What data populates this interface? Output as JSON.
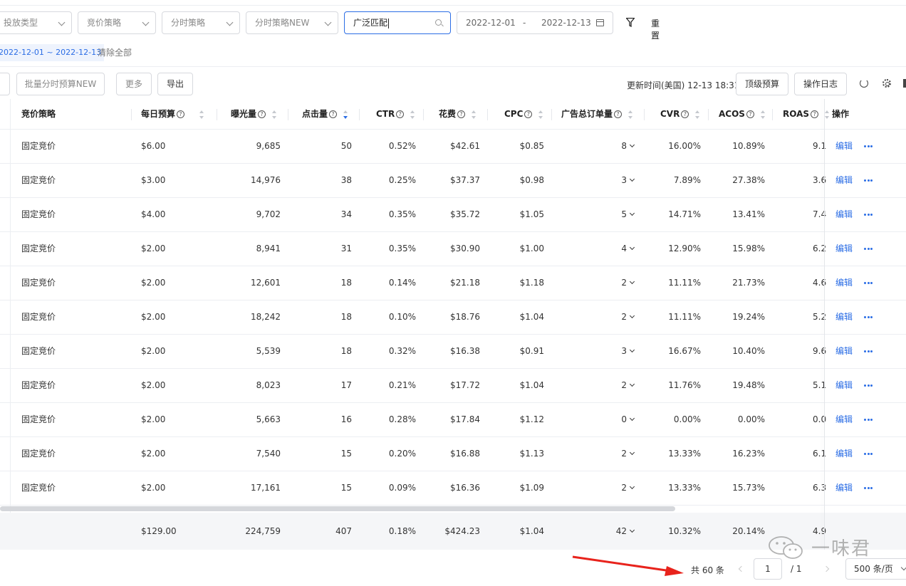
{
  "filters": {
    "delivery_type": "投放类型",
    "bid_strategy": "竞价策略",
    "dayparting": "分时策略",
    "dayparting_new": "分时策略NEW",
    "search_value": "广泛匹配",
    "date_start": "2022-12-01",
    "date_sep": "-",
    "date_end": "2022-12-13",
    "reset": "重置"
  },
  "active_tag": "2022-12-01 ~ 2022-12-13",
  "clear_all": "清除全部",
  "toolbar": {
    "batch_budget": "批量分时预算NEW",
    "more": "更多",
    "export": "导出",
    "updated_at": "更新时间(美国) 12-13 18:31",
    "top_budget": "顶级预算",
    "op_log": "操作日志"
  },
  "columns": {
    "bid": "竞价策略",
    "budget": "每日预算",
    "impr": "曝光量",
    "clicks": "点击量",
    "ctr": "CTR",
    "spend": "花费",
    "cpc": "CPC",
    "orders": "广告总订单量",
    "cvr": "CVR",
    "acos": "ACOS",
    "roas": "ROAS",
    "ops": "操作"
  },
  "rows": [
    {
      "bid": "固定竞价",
      "budget": "$6.00",
      "impr": "9,685",
      "clicks": "50",
      "ctr": "0.52%",
      "spend": "$42.61",
      "cpc": "$0.85",
      "orders": "8",
      "cvr": "16.00%",
      "acos": "10.89%",
      "roas": "9.1",
      "edit": "编辑"
    },
    {
      "bid": "固定竞价",
      "budget": "$3.00",
      "impr": "14,976",
      "clicks": "38",
      "ctr": "0.25%",
      "spend": "$37.37",
      "cpc": "$0.98",
      "orders": "3",
      "cvr": "7.89%",
      "acos": "27.38%",
      "roas": "3.6",
      "edit": "编辑"
    },
    {
      "bid": "固定竞价",
      "budget": "$4.00",
      "impr": "9,702",
      "clicks": "34",
      "ctr": "0.35%",
      "spend": "$35.72",
      "cpc": "$1.05",
      "orders": "5",
      "cvr": "14.71%",
      "acos": "13.41%",
      "roas": "7.4",
      "edit": "编辑"
    },
    {
      "bid": "固定竞价",
      "budget": "$2.00",
      "impr": "8,941",
      "clicks": "31",
      "ctr": "0.35%",
      "spend": "$30.90",
      "cpc": "$1.00",
      "orders": "4",
      "cvr": "12.90%",
      "acos": "15.98%",
      "roas": "6.2",
      "edit": "编辑"
    },
    {
      "bid": "固定竞价",
      "budget": "$2.00",
      "impr": "12,601",
      "clicks": "18",
      "ctr": "0.14%",
      "spend": "$21.18",
      "cpc": "$1.18",
      "orders": "2",
      "cvr": "11.11%",
      "acos": "21.73%",
      "roas": "4.6",
      "edit": "编辑"
    },
    {
      "bid": "固定竞价",
      "budget": "$2.00",
      "impr": "18,242",
      "clicks": "18",
      "ctr": "0.10%",
      "spend": "$18.76",
      "cpc": "$1.04",
      "orders": "2",
      "cvr": "11.11%",
      "acos": "19.24%",
      "roas": "5.2",
      "edit": "编辑"
    },
    {
      "bid": "固定竞价",
      "budget": "$2.00",
      "impr": "5,539",
      "clicks": "18",
      "ctr": "0.32%",
      "spend": "$16.38",
      "cpc": "$0.91",
      "orders": "3",
      "cvr": "16.67%",
      "acos": "10.40%",
      "roas": "9.6",
      "edit": "编辑"
    },
    {
      "bid": "固定竞价",
      "budget": "$2.00",
      "impr": "8,023",
      "clicks": "17",
      "ctr": "0.21%",
      "spend": "$17.72",
      "cpc": "$1.04",
      "orders": "2",
      "cvr": "11.76%",
      "acos": "19.48%",
      "roas": "5.1",
      "edit": "编辑"
    },
    {
      "bid": "固定竞价",
      "budget": "$2.00",
      "impr": "5,663",
      "clicks": "16",
      "ctr": "0.28%",
      "spend": "$17.84",
      "cpc": "$1.12",
      "orders": "0",
      "cvr": "0.00%",
      "acos": "0.00%",
      "roas": "0.0",
      "edit": "编辑"
    },
    {
      "bid": "固定竞价",
      "budget": "$2.00",
      "impr": "7,540",
      "clicks": "15",
      "ctr": "0.20%",
      "spend": "$16.88",
      "cpc": "$1.13",
      "orders": "2",
      "cvr": "13.33%",
      "acos": "16.23%",
      "roas": "6.1",
      "edit": "编辑"
    },
    {
      "bid": "固定竞价",
      "budget": "$2.00",
      "impr": "17,161",
      "clicks": "15",
      "ctr": "0.09%",
      "spend": "$16.36",
      "cpc": "$1.09",
      "orders": "2",
      "cvr": "13.33%",
      "acos": "15.73%",
      "roas": "6.3",
      "edit": "编辑"
    }
  ],
  "summary": {
    "budget": "$129.00",
    "impr": "224,759",
    "clicks": "407",
    "ctr": "0.18%",
    "spend": "$424.23",
    "cpc": "$1.04",
    "orders": "42",
    "cvr": "10.32%",
    "acos": "20.14%",
    "roas": "4.9"
  },
  "pagination": {
    "total": "共 60 条",
    "current_page": "1",
    "of_pages": "/ 1",
    "page_size": "500 条/页"
  },
  "watermark": "一味君",
  "colors": {
    "primary": "#2b6de5",
    "border": "#d7d9de",
    "annotation_arrow": "#e8231c"
  }
}
